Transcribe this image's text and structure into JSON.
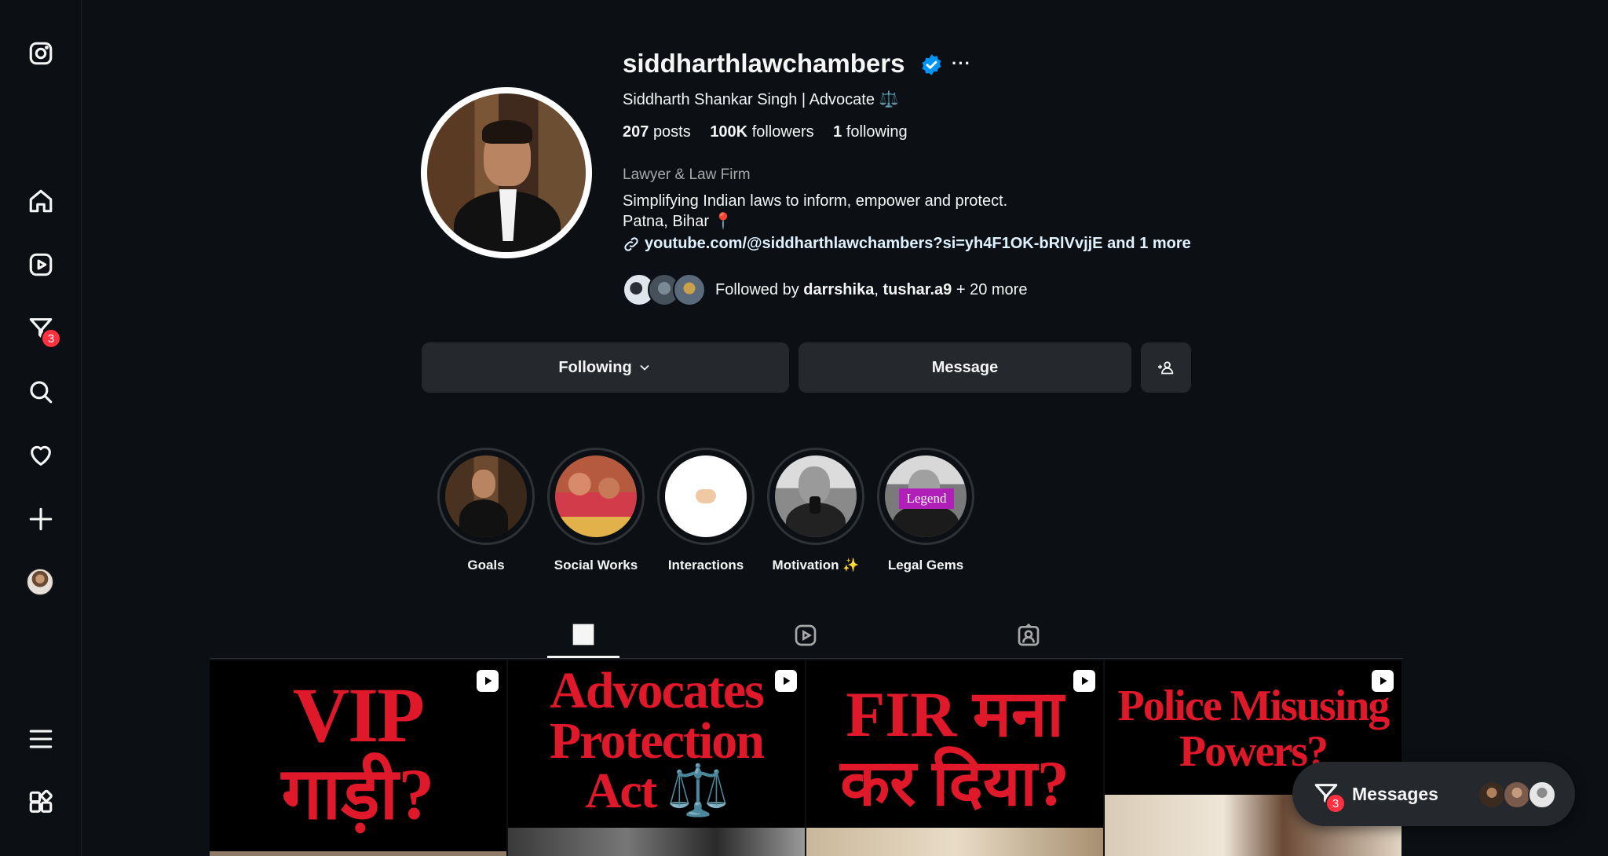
{
  "profile": {
    "username": "siddharthlawchambers",
    "full_name": "Siddharth Shankar Singh | Advocate ⚖️",
    "stats": {
      "posts_count": "207",
      "posts_label": "posts",
      "followers_count": "100K",
      "followers_label": "followers",
      "following_count": "1",
      "following_label": "following"
    },
    "category": "Lawyer & Law Firm",
    "bio_line1": "Simplifying Indian laws to inform, empower and protect.",
    "bio_line2": "Patna, Bihar 📍",
    "link": "youtube.com/@siddharthlawchambers?si=yh4F1OK-bRlVvjjE and 1 more",
    "followed_by_prefix": "Followed by ",
    "followed_by_user1": "darrshika",
    "followed_by_sep": ", ",
    "followed_by_user2": "tushar.a9",
    "followed_by_suffix": " + 20 more",
    "more_dots": "···"
  },
  "actions": {
    "following_label": "Following",
    "message_label": "Message"
  },
  "highlights": [
    {
      "label": "Goals"
    },
    {
      "label": "Social Works"
    },
    {
      "label": "Interactions"
    },
    {
      "label": "Motivation ✨"
    },
    {
      "label": "Legal Gems",
      "badge_text": "Legend"
    }
  ],
  "posts": [
    {
      "line1": "VIP",
      "line2": "गाड़ी?"
    },
    {
      "line1": "Advocates",
      "line2": "Protection",
      "line3": "Act ⚖️"
    },
    {
      "line1": "FIR मना",
      "line2": "कर दिया?"
    },
    {
      "line1": "Police Misusing",
      "line2": "Powers?"
    }
  ],
  "sidebar": {
    "notification_badge": "3"
  },
  "messages_bar": {
    "label": "Messages",
    "badge": "3"
  },
  "colors": {
    "background": "#0c1014",
    "button": "#25292e",
    "accent_badge": "#ff3040",
    "verified": "#0095f6",
    "post_text": "#e0192a"
  },
  "icons": [
    "instagram-icon",
    "home-icon",
    "reels-icon",
    "direct-icon",
    "search-icon",
    "heart-icon",
    "create-icon",
    "menu-icon",
    "more-apps-icon",
    "verified-icon",
    "link-icon",
    "chevron-down-icon",
    "add-person-icon",
    "grid-icon",
    "reels-tab-icon",
    "tagged-icon",
    "reel-badge-icon"
  ]
}
